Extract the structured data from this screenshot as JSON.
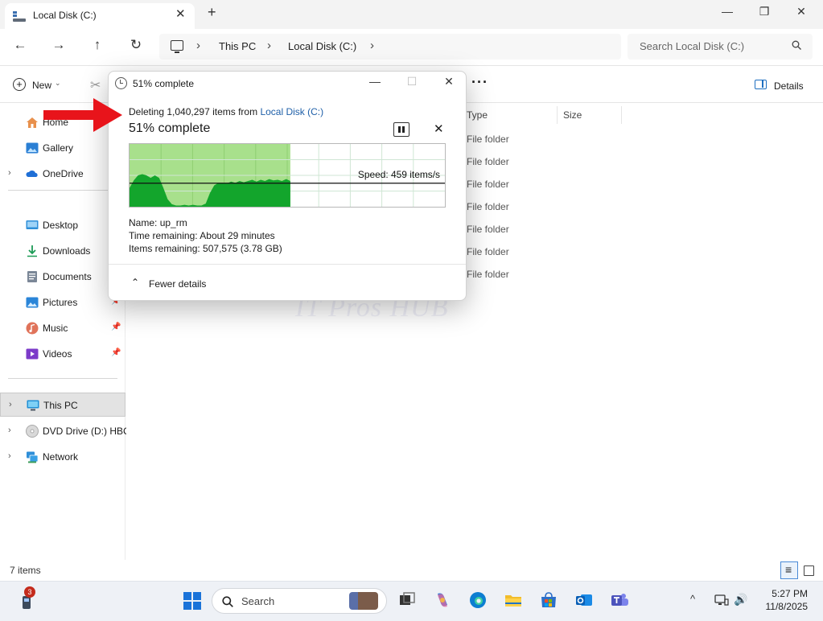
{
  "window": {
    "tab_title": "Local Disk (C:)",
    "new_tab": "+",
    "minimize": "—",
    "maximize": "❐",
    "close": "✕"
  },
  "nav": {
    "back": "←",
    "forward": "→",
    "up": "↑",
    "refresh": "↻",
    "breadcrumbs": [
      "This PC",
      "Local Disk (C:)"
    ],
    "chevron": "›",
    "search_placeholder": "Search Local Disk (C:)"
  },
  "commandbar": {
    "new_label": "New",
    "more": "···",
    "details_label": "Details"
  },
  "sidebar": {
    "quick": [
      {
        "label": "Home",
        "icon": "home-icon"
      },
      {
        "label": "Gallery",
        "icon": "gallery-icon"
      },
      {
        "label": "OneDrive",
        "icon": "onedrive-icon",
        "expandable": true
      }
    ],
    "pinned": [
      {
        "label": "Desktop",
        "icon": "desktop-icon"
      },
      {
        "label": "Downloads",
        "icon": "downloads-icon"
      },
      {
        "label": "Documents",
        "icon": "documents-icon"
      },
      {
        "label": "Pictures",
        "icon": "pictures-icon"
      },
      {
        "label": "Music",
        "icon": "music-icon"
      },
      {
        "label": "Videos",
        "icon": "videos-icon"
      }
    ],
    "devices": [
      {
        "label": "This PC",
        "icon": "this-pc-icon",
        "selected": true
      },
      {
        "label": "DVD Drive (D:) HBC",
        "icon": "dvd-icon"
      },
      {
        "label": "Network",
        "icon": "network-icon"
      }
    ],
    "expand_glyph": "›",
    "pin_glyph": "📌"
  },
  "filelist": {
    "columns": [
      "Type",
      "Size"
    ],
    "rows": [
      "File folder",
      "File folder",
      "File folder",
      "File folder",
      "File folder",
      "File folder",
      "File folder"
    ],
    "watermark": "IT Pros HUB"
  },
  "status": {
    "item_count": "7 items"
  },
  "dialog": {
    "title": "51% complete",
    "deleting_prefix": "Deleting 1,040,297 items from",
    "deleting_location": "Local Disk (C:)",
    "percent_label": "51% complete",
    "progress": 0.51,
    "speed_label": "Speed: 459 items/s",
    "name_label": "Name:",
    "name_value": "up_rm",
    "time_label": "Time remaining:",
    "time_value": "About 29 minutes",
    "items_label": "Items remaining:",
    "items_value": "507,575 (3.78 GB)",
    "fewer_details": "Fewer details",
    "minimize": "—",
    "maximize": "☐",
    "close": "✕",
    "stop": "✕",
    "speed_history": [
      0.3,
      0.42,
      0.5,
      0.52,
      0.5,
      0.46,
      0.5,
      0.46,
      0.3,
      0.12,
      0.04,
      0.02,
      0.02,
      0.03,
      0.02,
      0.03,
      0.02,
      0.02,
      0.05,
      0.22,
      0.34,
      0.38,
      0.38,
      0.37,
      0.4,
      0.38,
      0.41,
      0.39,
      0.41,
      0.43,
      0.4,
      0.43,
      0.41,
      0.44,
      0.42,
      0.43,
      0.41,
      0.44,
      0.41
    ]
  },
  "taskbar": {
    "badge": "3",
    "search_label": "Search",
    "time": "5:27 PM",
    "date": "11/8/2025",
    "tray_chevron": "^",
    "volume": "🔊"
  },
  "colors": {
    "accent": "#1a73d9",
    "graph_fill": "#a8e08c",
    "graph_speed": "#13a52c",
    "arrow": "#e8141b"
  }
}
